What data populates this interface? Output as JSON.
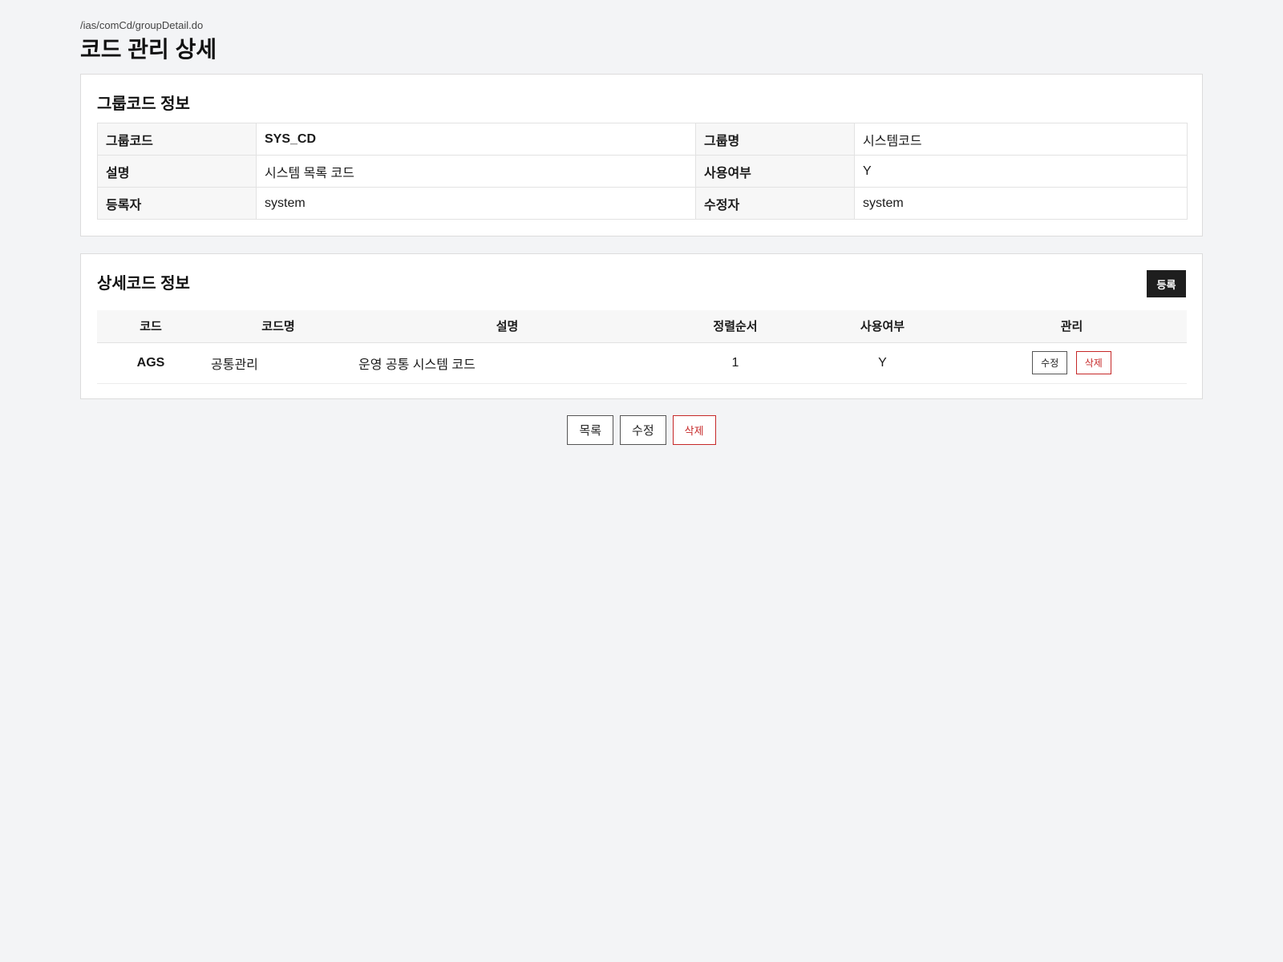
{
  "page": {
    "url_path": "/ias/comCd/groupDetail.do",
    "title": "코드 관리 상세"
  },
  "group_info": {
    "section_title": "그룹코드 정보",
    "rows": [
      {
        "label1": "그룹코드",
        "value1": "SYS_CD",
        "label2": "그룹명",
        "value2": "시스템코드"
      },
      {
        "label1": "설명",
        "value1": "시스템 목록 코드",
        "label2": "사용여부",
        "value2": "Y"
      },
      {
        "label1": "등록자",
        "value1": "system",
        "label2": "수정자",
        "value2": "system"
      }
    ]
  },
  "detail_info": {
    "section_title": "상세코드 정보",
    "register_label": "등록",
    "headers": [
      "코드",
      "코드명",
      "설명",
      "정렬순서",
      "사용여부",
      "관리"
    ],
    "rows": [
      {
        "code": "AGS",
        "name": "공통관리",
        "description": "운영 공통 시스템 코드",
        "sort_order": "1",
        "use_yn": "Y",
        "edit_label": "수정",
        "delete_label": "삭제"
      }
    ]
  },
  "actions": {
    "list_label": "목록",
    "edit_label": "수정",
    "delete_label": "삭제"
  },
  "colors": {
    "background": "#f3f4f6",
    "danger": "#c62828",
    "dark_button": "#1e1e1e"
  }
}
